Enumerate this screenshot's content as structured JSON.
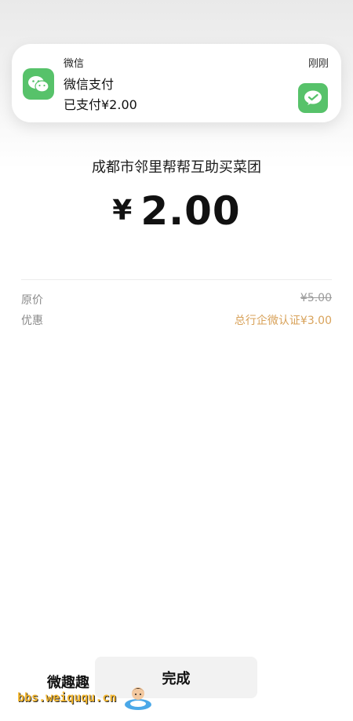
{
  "notification": {
    "app_name": "微信",
    "time": "刚刚",
    "title": "微信支付",
    "body": "已支付¥2.00",
    "app_icon": "wechat-icon",
    "pay_icon": "wechat-pay-icon",
    "accent": "#57c26a"
  },
  "payment": {
    "merchant": "成都市邻里帮帮互助买菜团",
    "currency": "¥",
    "amount": "2.00"
  },
  "details": [
    {
      "label": "原价",
      "value": "¥5.00"
    },
    {
      "label": "优惠",
      "value": "总行企微认证¥3.00"
    }
  ],
  "done_label": "完成",
  "watermark": {
    "cn": "微趣趣",
    "en": "bbs.weiququ.cn"
  }
}
